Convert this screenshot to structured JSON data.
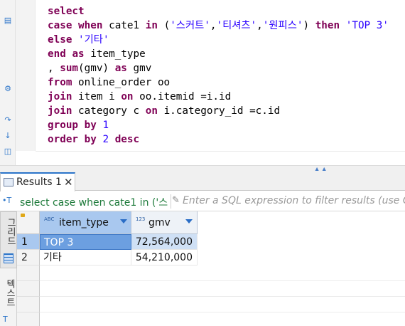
{
  "editor": {
    "lines": [
      [
        {
          "t": "select",
          "c": "kw"
        }
      ],
      [
        {
          "t": "case ",
          "c": "kw"
        },
        {
          "t": "when ",
          "c": "kw"
        },
        {
          "t": "cate1 ",
          "c": ""
        },
        {
          "t": "in ",
          "c": "kw"
        },
        {
          "t": "(",
          "c": ""
        },
        {
          "t": "'스커트'",
          "c": "str"
        },
        {
          "t": ",",
          "c": ""
        },
        {
          "t": "'티셔츠'",
          "c": "str"
        },
        {
          "t": ",",
          "c": ""
        },
        {
          "t": "'원피스'",
          "c": "str"
        },
        {
          "t": ") ",
          "c": ""
        },
        {
          "t": "then ",
          "c": "kw"
        },
        {
          "t": "'TOP 3'",
          "c": "str"
        }
      ],
      [
        {
          "t": "else ",
          "c": "kw"
        },
        {
          "t": "'기타'",
          "c": "str"
        }
      ],
      [
        {
          "t": "end ",
          "c": "kw"
        },
        {
          "t": "as ",
          "c": "kw"
        },
        {
          "t": "item_type",
          "c": ""
        }
      ],
      [
        {
          "t": ", ",
          "c": ""
        },
        {
          "t": "sum",
          "c": "kw"
        },
        {
          "t": "(gmv) ",
          "c": ""
        },
        {
          "t": "as ",
          "c": "kw"
        },
        {
          "t": "gmv",
          "c": ""
        }
      ],
      [
        {
          "t": "from ",
          "c": "kw"
        },
        {
          "t": "online_order oo",
          "c": ""
        }
      ],
      [
        {
          "t": "join ",
          "c": "kw"
        },
        {
          "t": "item i ",
          "c": ""
        },
        {
          "t": "on ",
          "c": "kw"
        },
        {
          "t": "oo.itemid =i.id",
          "c": ""
        }
      ],
      [
        {
          "t": "join ",
          "c": "kw"
        },
        {
          "t": "category c ",
          "c": ""
        },
        {
          "t": "on ",
          "c": "kw"
        },
        {
          "t": "i.category_id =c.id",
          "c": ""
        }
      ],
      [
        {
          "t": "group ",
          "c": "kw"
        },
        {
          "t": "by ",
          "c": "kw"
        },
        {
          "t": "1",
          "c": "num"
        }
      ],
      [
        {
          "t": "order ",
          "c": "kw"
        },
        {
          "t": "by ",
          "c": "kw"
        },
        {
          "t": "2 ",
          "c": "num"
        },
        {
          "t": "desc",
          "c": "kw"
        }
      ]
    ]
  },
  "results": {
    "tab_label": "Results 1",
    "tab_close": "✕",
    "filter_query": "select case when cate1 in ('스",
    "filter_placeholder": "Enter a SQL expression to filter results (use Ctrl",
    "side_tabs": {
      "grid": "그리드",
      "text": "텍스트"
    },
    "columns": [
      {
        "type_badge": "ABC",
        "name": "item_type"
      },
      {
        "type_badge": "123",
        "name": "gmv"
      }
    ],
    "rows": [
      {
        "num": "1",
        "item_type": "TOP 3",
        "gmv": "72,564,000"
      },
      {
        "num": "2",
        "item_type": "기타",
        "gmv": "54,210,000"
      }
    ]
  },
  "colors": {
    "keyword": "#7f0055",
    "string": "#2a00ff",
    "selection": "#6c9fe0",
    "accent": "#2b74c9"
  }
}
